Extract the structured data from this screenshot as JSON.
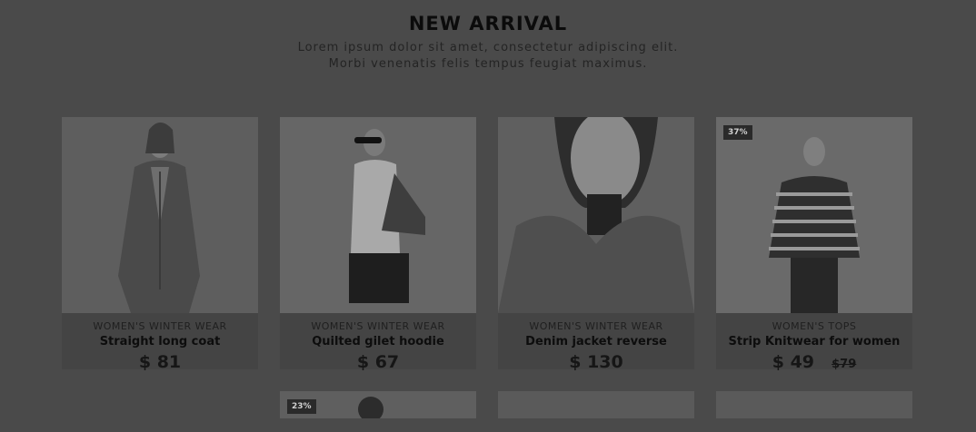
{
  "section": {
    "title": "NEW ARRIVAL",
    "subtitle_line1": "Lorem ipsum dolor sit amet, consectetur adipiscing elit.",
    "subtitle_line2": "Morbi venenatis felis tempus feugiat maximus."
  },
  "products": [
    {
      "category": "WOMEN'S WINTER WEAR",
      "name": "Straight long coat",
      "price": "$ 81",
      "old_price": "",
      "badge": ""
    },
    {
      "category": "WOMEN'S WINTER WEAR",
      "name": "Quilted gilet hoodie",
      "price": "$ 67",
      "old_price": "",
      "badge": ""
    },
    {
      "category": "WOMEN'S WINTER WEAR",
      "name": "Denim jacket reverse",
      "price": "$ 130",
      "old_price": "",
      "badge": ""
    },
    {
      "category": "WOMEN'S TOPS",
      "name": "Strip Knitwear for women",
      "price": "$ 49",
      "old_price": "$79",
      "badge": "37%"
    }
  ],
  "row2_badge": "23%",
  "colors": {
    "overlay": "#4a4a4a"
  }
}
